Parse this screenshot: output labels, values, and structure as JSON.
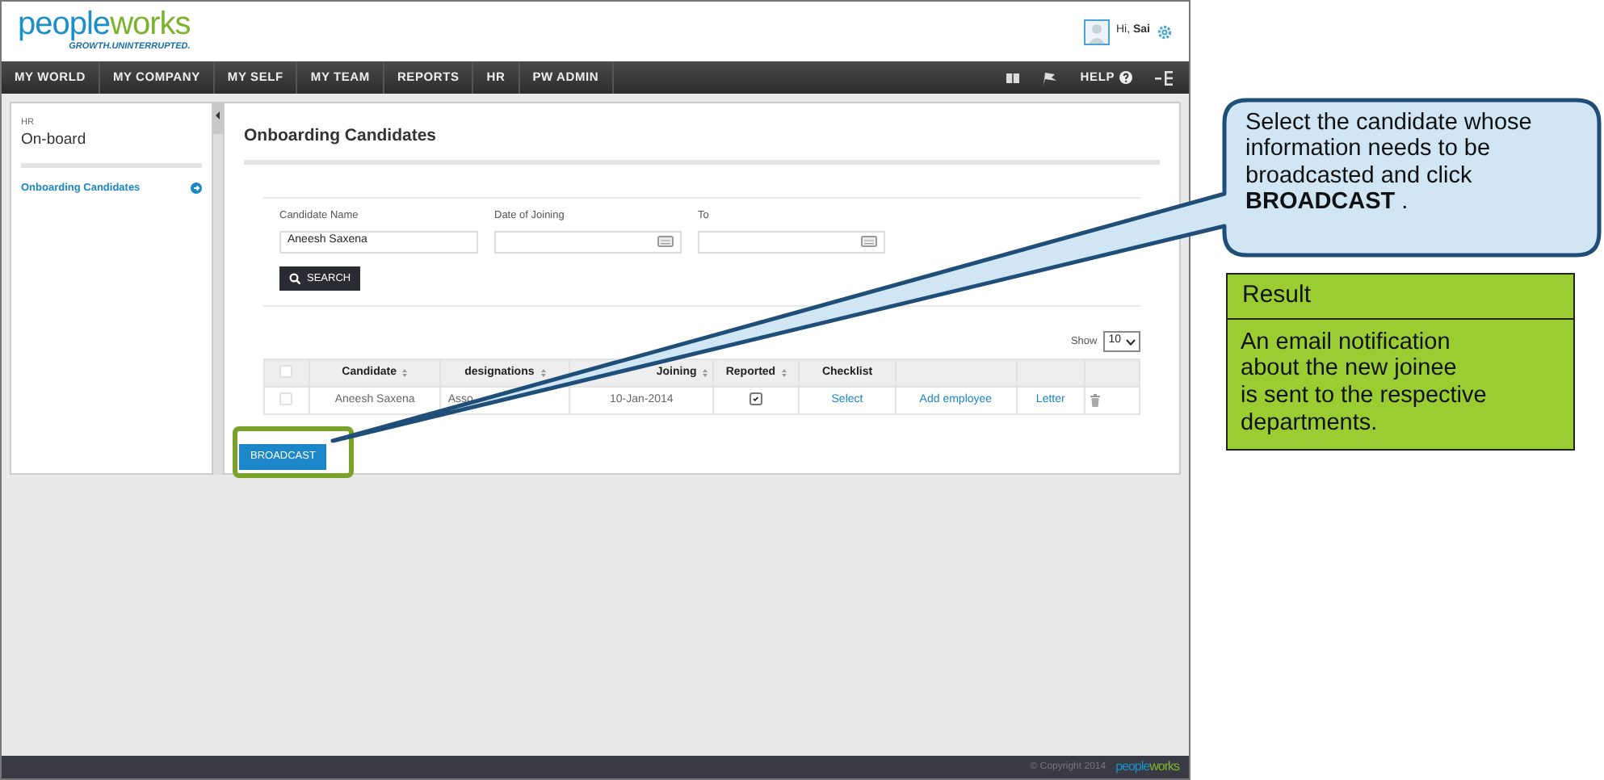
{
  "header": {
    "logo": {
      "text": "peopleworks",
      "tagline": "GROWTH.UNINTERRUPTED."
    },
    "greeting": "Hi,",
    "user": "Sai"
  },
  "nav": {
    "items": [
      "MY WORLD",
      "MY COMPANY",
      "MY SELF",
      "MY TEAM",
      "REPORTS",
      "HR",
      "PW ADMIN"
    ],
    "help": "HELP"
  },
  "sidebar": {
    "section": "HR",
    "title": "On-board",
    "items": [
      {
        "label": "Onboarding Candidates",
        "selected": true
      }
    ]
  },
  "main": {
    "title": "Onboarding Candidates",
    "filters": [
      {
        "label": "Candidate Name",
        "kind": "text",
        "value": "Aneesh  Saxena"
      },
      {
        "label": "Date of Joining",
        "kind": "date"
      },
      {
        "label": "To",
        "kind": "date"
      }
    ],
    "search_button": "SEARCH",
    "show_label": "Show",
    "page_size": "10",
    "table": {
      "header_checked": false,
      "columns": [
        {
          "kind": "checkbox"
        },
        {
          "kind": "text",
          "label": "Candidate",
          "sortable": true
        },
        {
          "kind": "text",
          "label": "designations",
          "sortable": true
        },
        {
          "kind": "text",
          "label": "Joining",
          "sortable": true
        },
        {
          "kind": "check",
          "label": "Reported",
          "sortable": true
        },
        {
          "kind": "link",
          "label": "Checklist",
          "sortable": false
        },
        {
          "kind": "link"
        },
        {
          "kind": "link"
        },
        {
          "kind": "trash"
        }
      ],
      "rows": [
        {
          "checked": false,
          "cells": [
            "",
            "Aneesh Saxena",
            "Asso",
            "10-Jan-2014",
            true,
            "Select",
            "Add employee",
            "Letter",
            ""
          ]
        }
      ]
    },
    "broadcast_button": "BROADCAST"
  },
  "footer": {
    "copyright": "© Copyright 2014",
    "logo": "peopleworks"
  },
  "callout": {
    "text": "Select the candidate whose information needs to be broadcasted and click **BROADCAST** ."
  },
  "result": {
    "title": "Result",
    "lines": [
      "An email notification",
      "about the new joinee",
      "is sent to the respective",
      "departments."
    ]
  }
}
